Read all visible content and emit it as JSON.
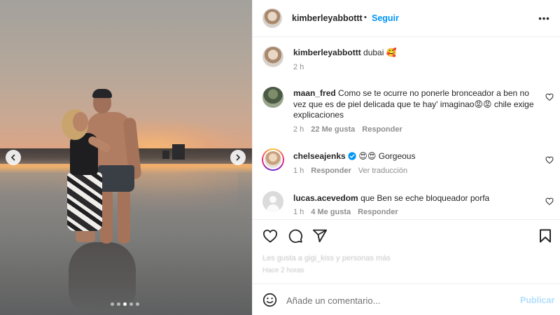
{
  "photo": {
    "carousel_total": 5,
    "carousel_active_index": 2
  },
  "header": {
    "username": "kimberleyabbottt",
    "separator": "•",
    "follow_label": "Seguir"
  },
  "caption": {
    "username": "kimberleyabbottt",
    "text": "dubai 🥰",
    "time": "2 h"
  },
  "comments": [
    {
      "username": "maan_fred",
      "text": "Como se te ocurre no ponerle bronceador a ben no vez que es de piel delicada que te hay' imaginao😡😡 chile exige explicaciones",
      "time": "2 h",
      "likes": "22 Me gusta",
      "reply": "Responder"
    },
    {
      "username": "chelseajenks",
      "verified": true,
      "text": "😍😍 Gorgeous",
      "time": "1 h",
      "reply": "Responder",
      "translate": "Ver traducción"
    },
    {
      "username": "lucas.acevedom",
      "text": "que Ben se eche bloqueador porfa",
      "time": "1 h",
      "likes": "4 Me gusta",
      "reply": "Responder"
    }
  ],
  "actions": {
    "likes_text": "Les gusta a gigi_kiss y personas más",
    "time_text": "Hace 2 horas"
  },
  "composer": {
    "placeholder": "Añade un comentario...",
    "publish_label": "Publicar"
  },
  "colors": {
    "accent": "#0095f6",
    "publish_disabled": "#b2dffc",
    "muted": "#8e8e8e"
  },
  "icons": [
    "chevron-left-icon",
    "chevron-right-icon",
    "more-icon",
    "heart-icon",
    "comment-icon",
    "share-icon",
    "bookmark-icon",
    "emoji-icon",
    "verified-badge-icon"
  ]
}
